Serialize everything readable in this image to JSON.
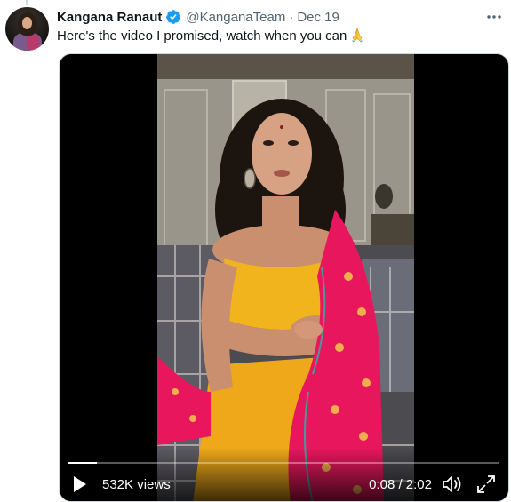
{
  "tweet": {
    "author_name": "Kangana Ranaut",
    "handle": "@KanganaTeam",
    "separator": "·",
    "date": "Dec 19",
    "text": "Here's the video I promised, watch when you can",
    "emoji_icon": "folded-hands-icon",
    "verified_icon": "verified-badge-icon",
    "more_icon": "more-options-icon"
  },
  "video": {
    "views": "532K views",
    "time": "0:08 / 2:02",
    "progress_fraction": 0.066,
    "play_icon": "play-icon",
    "volume_icon": "volume-icon",
    "fullscreen_icon": "fullscreen-icon"
  },
  "colors": {
    "verified_blue": "#1d9bf0",
    "secondary_text": "#536471",
    "primary_text": "#0f1419",
    "saree_yellow": "#f2b41c",
    "dupatta_pink": "#e8175d"
  }
}
